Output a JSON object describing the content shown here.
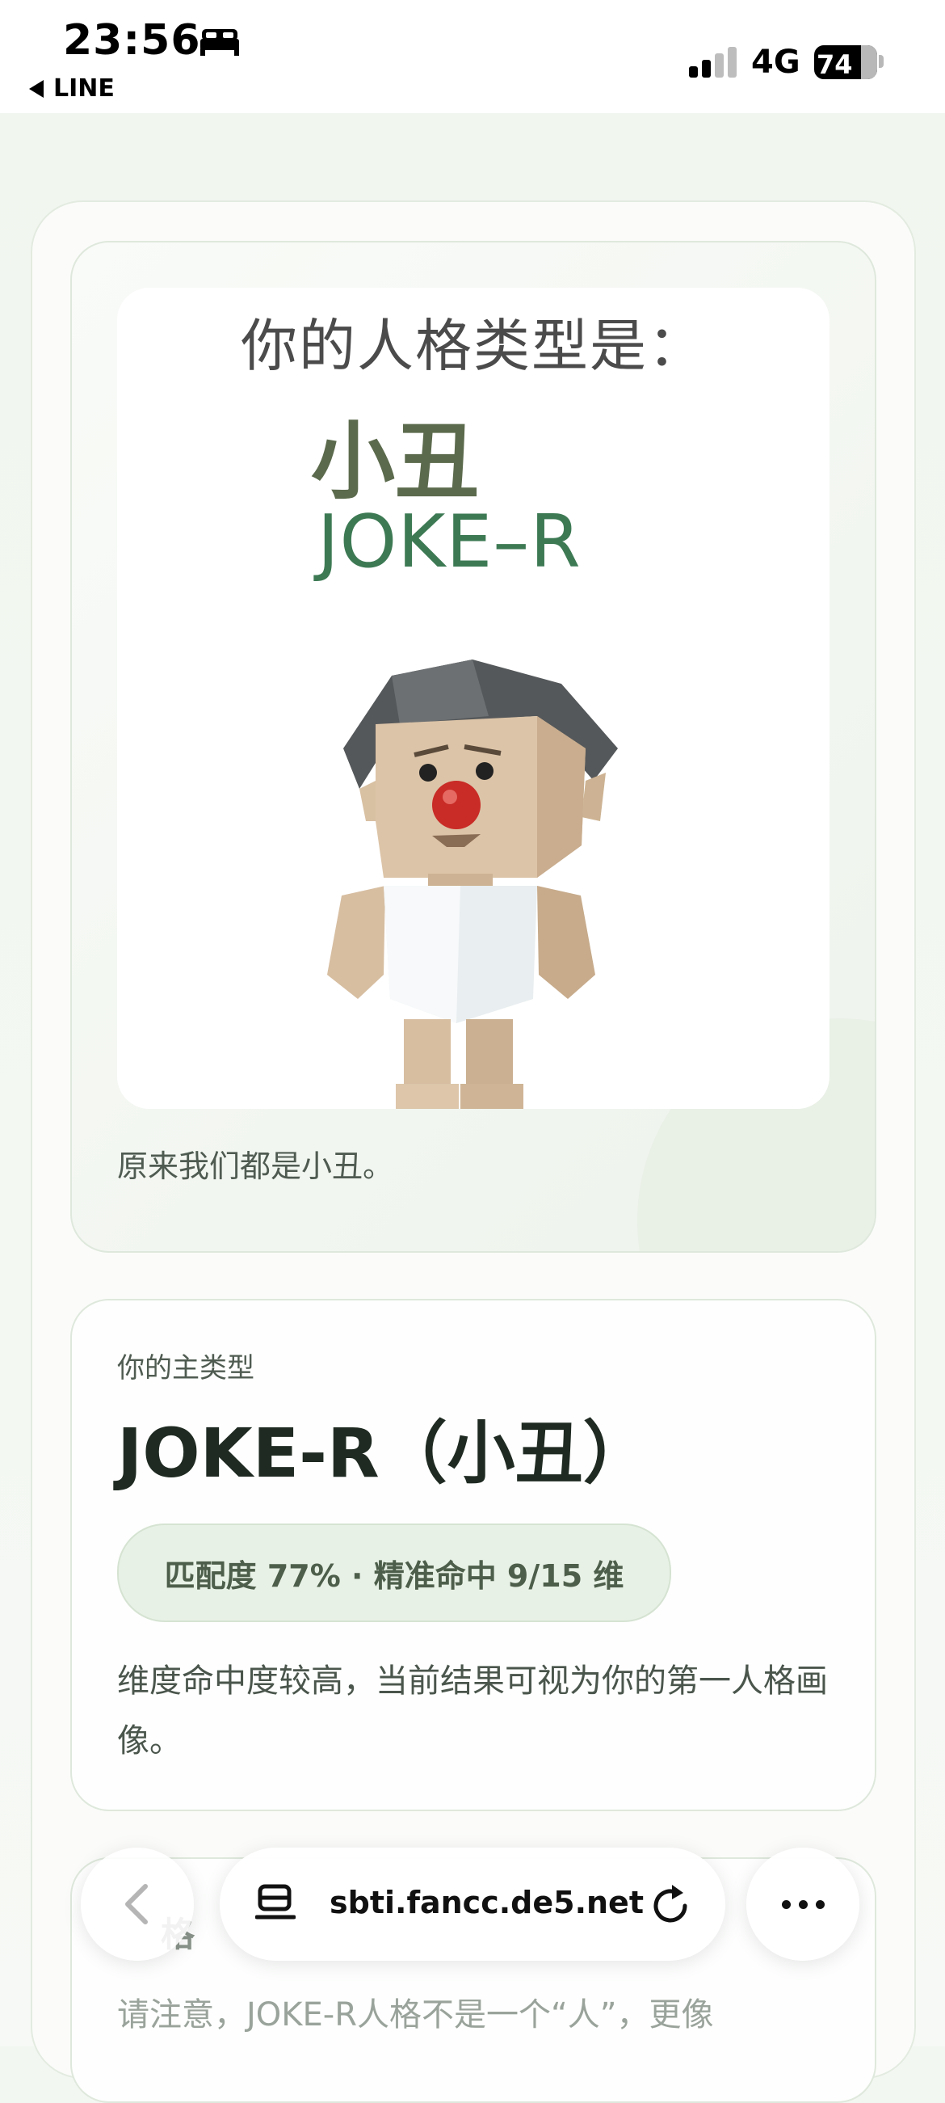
{
  "status_bar": {
    "time": "23:56",
    "back_app": "LINE",
    "network": "4G",
    "battery": "74"
  },
  "result_card": {
    "image_heading": "你的人格类型是：",
    "image_name": "小丑",
    "image_code": "JOKE–R",
    "caption": "原来我们都是小丑。"
  },
  "type_card": {
    "label": "你的主类型",
    "title": "JOKE-R（小丑）",
    "match": "匹配度 77% · 精准命中 9/15 维",
    "description": "维度命中度较高，当前结果可视为你的第一人格画像。"
  },
  "third_card": {
    "title": "格",
    "text": "请注意，JOKE-R人格不是一个“人”，更像"
  },
  "browser": {
    "url": "sbti.fancc.de5.net"
  }
}
